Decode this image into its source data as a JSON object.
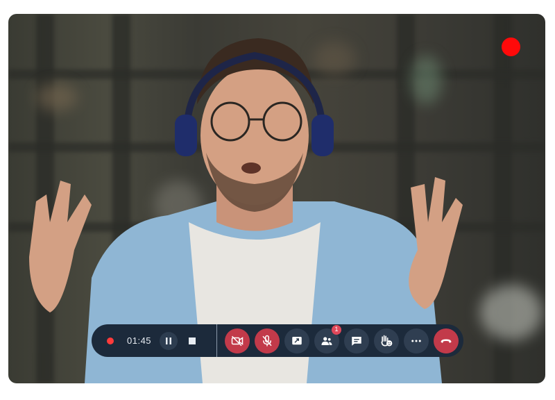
{
  "recording": {
    "timer": "01:45",
    "indicator_color": "#ff3b3b",
    "overlay_dot_color": "#ff0a0a"
  },
  "controls": {
    "pause_icon": "pause-icon",
    "stop_icon": "stop-icon",
    "tools": [
      {
        "name": "camera-off-button",
        "icon": "video-off-icon",
        "variant": "red"
      },
      {
        "name": "mic-off-button",
        "icon": "mic-off-icon",
        "variant": "red"
      },
      {
        "name": "share-screen-button",
        "icon": "share-screen-icon",
        "variant": "dark"
      },
      {
        "name": "participants-button",
        "icon": "participants-icon",
        "variant": "dark",
        "badge": "1"
      },
      {
        "name": "chat-button",
        "icon": "chat-icon",
        "variant": "dark"
      },
      {
        "name": "raise-hand-button",
        "icon": "raise-hand-icon",
        "variant": "dark"
      },
      {
        "name": "more-options-button",
        "icon": "more-icon",
        "variant": "dark"
      },
      {
        "name": "end-call-button",
        "icon": "hang-up-icon",
        "variant": "red"
      }
    ]
  },
  "colors": {
    "bar": "#1c2a3b",
    "button": "#2f3e51",
    "danger": "#c23a4a"
  }
}
